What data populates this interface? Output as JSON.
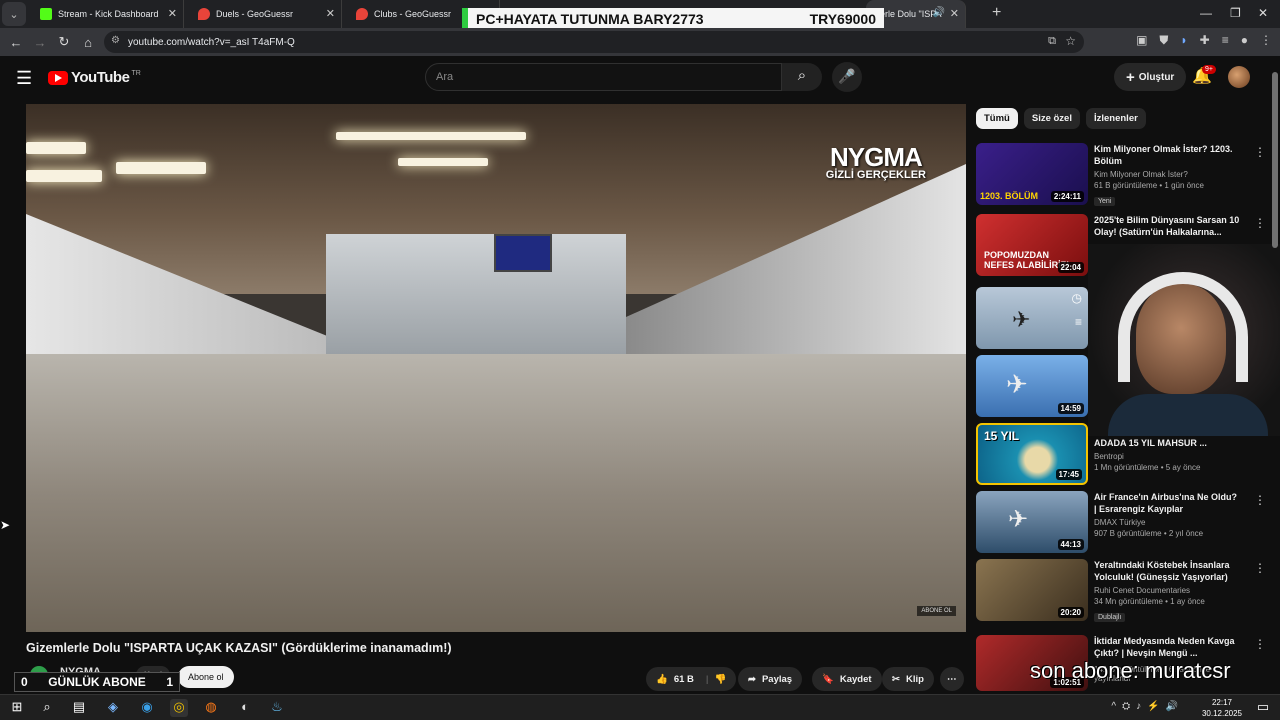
{
  "browser": {
    "tabs": [
      {
        "label": "Stream - Kick Dashboard",
        "color": "#53fc18"
      },
      {
        "label": "Duels - GeoGuessr",
        "color": "#e8443a"
      },
      {
        "label": "Clubs - GeoGuessr",
        "color": "#e8443a"
      },
      {
        "label": "erle Dolu \"ISPA",
        "color": "#ff0000"
      }
    ],
    "url": "youtube.com/watch?v=_asI T4aFM-Q"
  },
  "banner": {
    "left_text": "PC+HAYATA TUTUNMA BARY2773",
    "right_text": "TRY69000"
  },
  "youtube": {
    "logo": "YouTube",
    "region": "TR",
    "search_placeholder": "Ara",
    "create_label": "Oluştur",
    "notif_count": "9+"
  },
  "video": {
    "watermark_big": "NYGMA",
    "watermark_small": "GİZLİ GERÇEKLER",
    "corner_tag": "ABONE OL",
    "title": "Gizemlerle Dolu \"ISPARTA UÇAK KAZASI\" (Gördüklerime inanamadım!)",
    "channel": "NYGMA",
    "join_label": "Katıl",
    "subscribe_label": "Abone ol",
    "like_count": "61 B",
    "share_label": "Paylaş",
    "save_label": "Kaydet",
    "clip_label": "Klip"
  },
  "overlay": {
    "daily_left": "0",
    "daily_label": "GÜNLÜK ABONE",
    "daily_right": "1",
    "last_sub": "son abone: muratcsr"
  },
  "sidebar": {
    "chips": [
      "Tümü",
      "Size özel",
      "İzlenenler"
    ],
    "recs": [
      {
        "title": "Kim Milyoner Olmak İster? 1203. Bölüm",
        "channel": "Kim Milyoner Olmak İster?",
        "meta": "61 B görüntüleme • 1 gün önce",
        "badge": "Yeni",
        "duration": "2:24:11",
        "thumb_color": "#2a1a6e"
      },
      {
        "title": "2025'te Bilim Dünyasını Sarsan 10 Olay! (Satürn'ün Halkalarına...",
        "channel": "",
        "meta": "",
        "badge": "",
        "duration": "22:04",
        "thumb_color": "#c8282a"
      },
      {
        "title": "",
        "channel": "",
        "meta": "",
        "badge": "",
        "duration": "",
        "thumb_color": "#9fb4c8"
      },
      {
        "title": "",
        "channel": "",
        "meta": "",
        "badge": "",
        "duration": "14:59",
        "thumb_color": "#5b8fc9"
      },
      {
        "title": "ADADA 15 YIL MAHSUR ...",
        "channel": "Bentropi",
        "meta": "1 Mn görüntüleme • 5 ay önce",
        "badge": "",
        "duration": "17:45",
        "thumb_color": "#1a8fb0"
      },
      {
        "title": "Air France'ın Airbus'ına Ne Oldu? | Esrarengiz Kayıplar",
        "channel": "DMAX Türkiye",
        "meta": "907 B görüntüleme • 2 yıl önce",
        "badge": "",
        "duration": "44:13",
        "thumb_color": "#3c5a78"
      },
      {
        "title": "Yeraltındaki Köstebek İnsanlara Yolculuk! (Güneşsiz Yaşıyorlar)",
        "channel": "Ruhi Cenet Documentaries",
        "meta": "34 Mn görüntüleme • 1 ay önce",
        "badge": "Dublajlı",
        "duration": "20:20",
        "thumb_color": "#6a5a40"
      },
      {
        "title": "İktidar Medyasında Neden Kavga Çıktı? | Nevşin Mengü ...",
        "channel": "",
        "meta": "141 B görüntüleme • 6 saat önce yayınlandı",
        "badge": "",
        "duration": "1:02:51",
        "thumb_color": "#8a2020"
      }
    ]
  },
  "taskbar": {
    "time": "22:17",
    "date": "30.12.2025"
  }
}
